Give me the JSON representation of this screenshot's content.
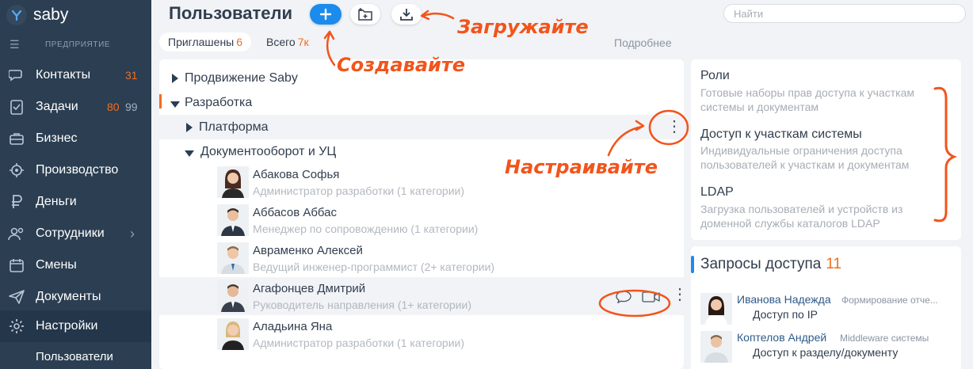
{
  "app": {
    "logo_text": "saby",
    "company_label": "ПРЕДПРИЯТИЕ"
  },
  "sidebar": {
    "items": [
      {
        "label": "Контакты",
        "count": "31",
        "icon": "contacts-icon"
      },
      {
        "label": "Задачи",
        "count_a": "80",
        "count_b": "99",
        "icon": "tasks-icon"
      },
      {
        "label": "Бизнес",
        "icon": "business-icon"
      },
      {
        "label": "Производство",
        "icon": "production-icon"
      },
      {
        "label": "Деньги",
        "icon": "money-icon"
      },
      {
        "label": "Сотрудники",
        "icon": "employees-icon"
      },
      {
        "label": "Смены",
        "icon": "shifts-icon"
      },
      {
        "label": "Документы",
        "icon": "documents-icon"
      },
      {
        "label": "Настройки",
        "icon": "settings-icon"
      }
    ],
    "sub_item": "Пользователи"
  },
  "header": {
    "title": "Пользователи",
    "search_placeholder": "Найти"
  },
  "tabs": [
    {
      "label": "Приглашены",
      "count": "6"
    },
    {
      "label": "Всего",
      "count": "7к"
    }
  ],
  "more_link": "Подробнее",
  "groups": [
    {
      "label": "Продвижение Saby",
      "state": "collapsed"
    },
    {
      "label": "Разработка",
      "state": "expanded"
    },
    {
      "label": "Платформа",
      "state": "collapsed"
    },
    {
      "label": "Документооборот и УЦ",
      "state": "expanded"
    }
  ],
  "users": [
    {
      "name": "Абакова Софья",
      "role": "Администратор разработки (1 категории)",
      "gender": "f"
    },
    {
      "name": "Аббасов Аббас",
      "role": "Менеджер по сопровождению (1 категории)",
      "gender": "m"
    },
    {
      "name": "Авраменко Алексей",
      "role": "Ведущий инженер-программист (2+ категории)",
      "gender": "m"
    },
    {
      "name": "Агафонцев Дмитрий",
      "role": "Руководитель направления (1+ категории)",
      "gender": "m"
    },
    {
      "name": "Аладьина Яна",
      "role": "Администратор разработки (1 категории)",
      "gender": "f"
    }
  ],
  "right_panel": [
    {
      "title": "Роли",
      "desc": "Готовые наборы прав доступа к участкам системы и документам"
    },
    {
      "title": "Доступ к участкам системы",
      "desc": "Индивидуальные ограничения доступа пользователей к участкам и документам"
    },
    {
      "title": "LDAP",
      "desc": "Загрузка пользователей и устройств из доменной службы каталогов LDAP"
    }
  ],
  "requests": {
    "title": "Запросы доступа",
    "count": "11",
    "items": [
      {
        "name": "Иванова Надежда",
        "dept": "Формирование отче...",
        "text": "Доступ по IP"
      },
      {
        "name": "Коптелов Андрей",
        "dept": "Middleware системы",
        "text": "Доступ к разделу/документу"
      }
    ]
  },
  "annotations": {
    "load": "Загружайте",
    "create": "Создавайте",
    "configure": "Настраивайте"
  },
  "colors": {
    "sidebar_bg": "#2b3e52",
    "accent_blue": "#1b8cec",
    "accent_orange": "#f26d1f",
    "annotation": "#f2541b"
  }
}
